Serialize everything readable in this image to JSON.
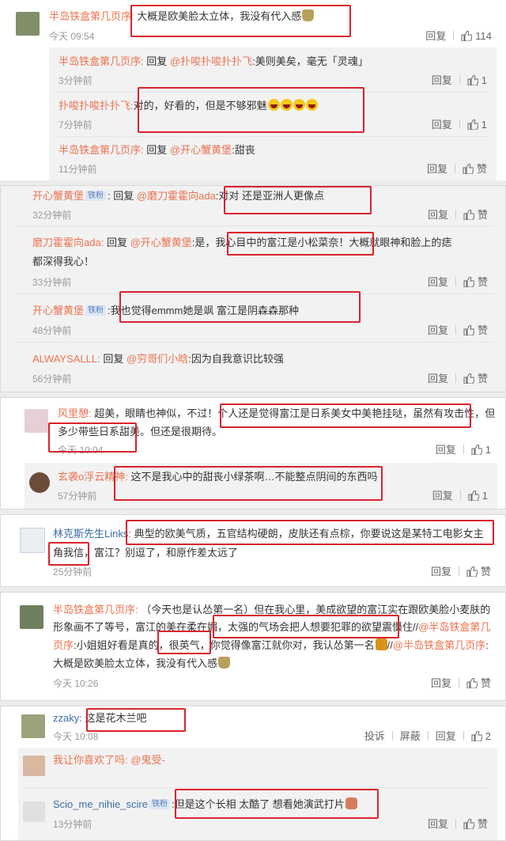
{
  "colors": {
    "username": "#eb7350",
    "mention": "#eb7350",
    "highlight": "#d9232d",
    "badge_bg": "#dbe7f6"
  },
  "labels": {
    "reply": "回复",
    "like": "赞",
    "report": "投诉",
    "block": "屏蔽"
  },
  "panel1": {
    "main": {
      "user": "半岛铁盒第几页序:",
      "text": "大概是欧美脸太立体，我没有代入感",
      "time": "今天 09:54",
      "likes": "114"
    },
    "r1": {
      "user": "半岛铁盒第几页序:",
      "prefix": "回复",
      "mention": "@扑唆扑唆扑扑飞",
      "text": ":美则美矣，毫无「灵魂」",
      "time": "3分钟前",
      "likes": "1"
    },
    "r2": {
      "user": "扑唆扑唆扑扑飞:",
      "text": "对的，好看的，但是不够邪魅",
      "time": "7分钟前",
      "likes": "1"
    },
    "r3": {
      "user": "半岛铁盒第几页序:",
      "prefix": "回复",
      "mention": "@开心蟹黄堡",
      "text": ":甜丧",
      "time": "11分钟前"
    }
  },
  "panel2": {
    "c1": {
      "user": "开心蟹黄堡",
      "badge": "铁粉",
      "colon": ":",
      "prefix": "回复",
      "mention": "@磨刀霍霍向ada",
      "text": ":对对 还是亚洲人更像点",
      "time": "32分钟前"
    },
    "c2": {
      "user": "磨刀霍霍向ada:",
      "prefix": "回复",
      "mention": "@开心蟹黄堡",
      "text1": ":是，我心目中的富江是小松菜奈！大概就眼神和脸上的痣",
      "text2": "都深得我心！",
      "time": "33分钟前"
    },
    "c3": {
      "user": "开心蟹黄堡",
      "badge": "铁粉",
      "text": ":我也觉得emmm她是飒 富江是阴森森那种",
      "time": "48分钟前"
    },
    "c4": {
      "user": "ALWAYSALLL:",
      "prefix": "回复",
      "mention": "@穷哥们小晗",
      "text": ":因为自我意识比较强",
      "time": "56分钟前"
    }
  },
  "panel3": {
    "main": {
      "user": "风里憩:",
      "text1": "超美，眼睛也神似，不过！个人还是觉得富江是日系美女中美艳挂哒，虽然有攻击性，但",
      "text2": "多少带些日系甜美。但还是很期待。",
      "time": "今天 10:04",
      "likes": "1"
    },
    "sub": {
      "user": "玄袭o浮云精神:",
      "text": "这不是我心中的甜丧小绿茶啊…不能整点阴间的东西吗",
      "time": "57分钟前",
      "likes": "1"
    }
  },
  "panel4": {
    "main": {
      "user": "林克斯先生Links:",
      "text1": "典型的欧美气质，五官结构硬朗，皮肤还有点棕，你要说这是某特工电影女主",
      "text2": "角我信，富江？别逗了，和原作差太远了",
      "time": "25分钟前"
    }
  },
  "panel5": {
    "main": {
      "user": "半岛铁盒第几页序:",
      "text1": "（今天也是认怂第一名）但在我心里，美成欲望的富江实在跟欧美脸小麦肤的",
      "text2": "形象画不了等号，富江的美在柔在媚，太强的气场会把人想要犯罪的欲望震慑住//",
      "mention2": "@半岛铁盒第几",
      "text3a": "页序",
      "text3b": ":小姐姐好看是真的，很英气，你觉得像富江就你对，我认怂第一名",
      "mention3": "@半岛铁盒第几页序",
      "text3c": "//",
      "text3d": ":",
      "text4": "大概是欧美脸太立体，我没有代入感",
      "time": "今天 10:26"
    }
  },
  "panel6": {
    "main": {
      "user": "zzaky:",
      "text": "这是花木兰吧",
      "time": "今天 10:08",
      "likes": "2"
    },
    "sub1": {
      "user": "我让你喜欢了吗:",
      "mention": "@鬼受-"
    },
    "sub2": {
      "user": "Scio_me_nihie_scire",
      "badge": "铁粉",
      "text": ":但是这个长相 太酷了 想看她演武打片",
      "time": "13分钟前"
    }
  }
}
